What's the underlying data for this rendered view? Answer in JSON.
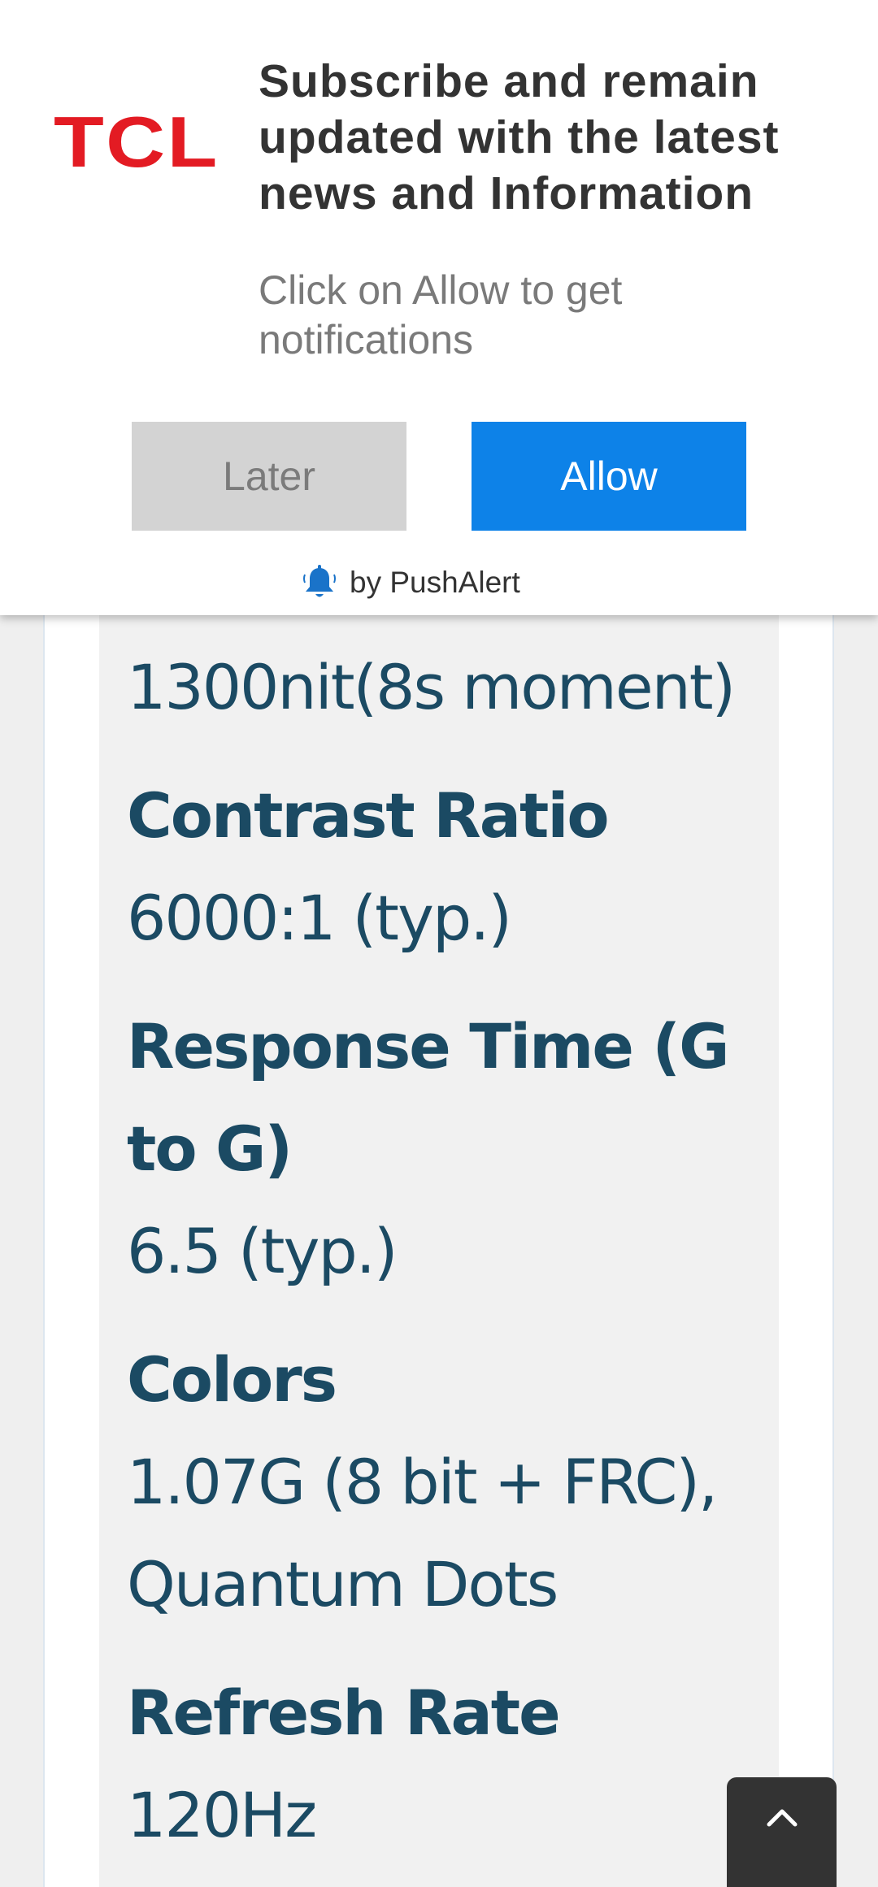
{
  "push_prompt": {
    "brand": "TCL",
    "title_lines": [
      "Subscribe and remain",
      "updated with the latest",
      "news and Information"
    ],
    "subtitle_lines": [
      "Click on Allow to get",
      "notifications"
    ],
    "later_label": "Later",
    "allow_label": "Allow",
    "powered_by": "by PushAlert",
    "brand_color": "#e31b23",
    "allow_color": "#0d82e8"
  },
  "specs": {
    "brightness_value": "1300nit(8s moment)",
    "contrast_label": "Contrast Ratio",
    "contrast_value": "6000:1 (typ.)",
    "response_label_line1": "Response Time (G",
    "response_label_line2": "to G)",
    "response_value": "6.5 (typ.)",
    "colors_label": "Colors",
    "colors_value_line1": "1.07G (8 bit + FRC),",
    "colors_value_line2": "Quantum Dots",
    "refresh_label": "Refresh Rate",
    "refresh_value": "120Hz",
    "text_color": "#1b4a63"
  },
  "back_to_top": {
    "icon": "chevron-up-icon"
  }
}
